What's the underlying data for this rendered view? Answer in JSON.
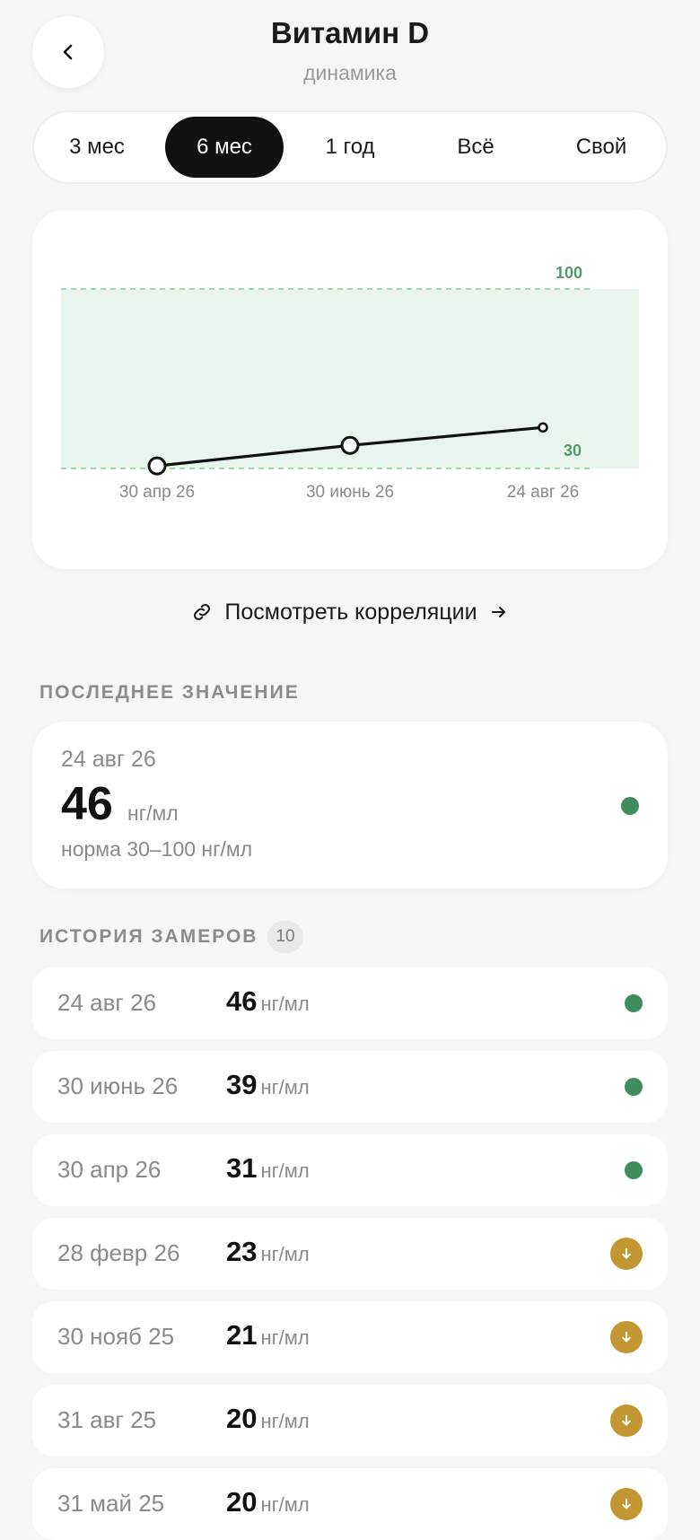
{
  "header": {
    "title": "Витамин D",
    "subtitle": "динамика"
  },
  "periods": [
    {
      "label": "3 мес",
      "active": false
    },
    {
      "label": "6 мес",
      "active": true
    },
    {
      "label": "1 год",
      "active": false
    },
    {
      "label": "Всё",
      "active": false
    },
    {
      "label": "Свой",
      "active": false
    }
  ],
  "chart_data": {
    "type": "line",
    "x": [
      "30 апр 26",
      "30 июнь 26",
      "24 авг 26"
    ],
    "series": [
      {
        "values": [
          31,
          39,
          46
        ]
      }
    ],
    "reference_band": {
      "low": 30,
      "high": 100,
      "low_label": "30",
      "high_label": "100",
      "color": "#e9f5ec"
    },
    "ylim": [
      30,
      100
    ],
    "grid": false,
    "colors": {
      "line": "#111111",
      "band_line": "#7fcf8f",
      "band_text": "#4f9a66"
    }
  },
  "correlations_link": {
    "label": "Посмотреть корреляции"
  },
  "last_value": {
    "section_label": "ПОСЛЕДНЕЕ ЗНАЧЕНИЕ",
    "date": "24 авг 26",
    "value": "46",
    "unit": "нг/мл",
    "norm": "норма 30–100 нг/мл",
    "status": "normal"
  },
  "history": {
    "section_label": "ИСТОРИЯ ЗАМЕРОВ",
    "count": "10",
    "rows": [
      {
        "date": "24 авг 26",
        "value": "46",
        "unit": "нг/мл",
        "status": "normal"
      },
      {
        "date": "30 июнь 26",
        "value": "39",
        "unit": "нг/мл",
        "status": "normal"
      },
      {
        "date": "30 апр 26",
        "value": "31",
        "unit": "нг/мл",
        "status": "normal"
      },
      {
        "date": "28 февр 26",
        "value": "23",
        "unit": "нг/мл",
        "status": "low"
      },
      {
        "date": "30 нояб 25",
        "value": "21",
        "unit": "нг/мл",
        "status": "low"
      },
      {
        "date": "31 авг 25",
        "value": "20",
        "unit": "нг/мл",
        "status": "low"
      },
      {
        "date": "31 май 25",
        "value": "20",
        "unit": "нг/мл",
        "status": "low"
      }
    ]
  },
  "colors": {
    "status_ok": "#3f8c5e",
    "status_low": "#c29630",
    "active_tab": "#111111"
  },
  "icons": {
    "back": "chevron-left-icon",
    "link": "link-icon",
    "arrow": "arrow-right-icon",
    "low": "arrow-down-icon"
  }
}
